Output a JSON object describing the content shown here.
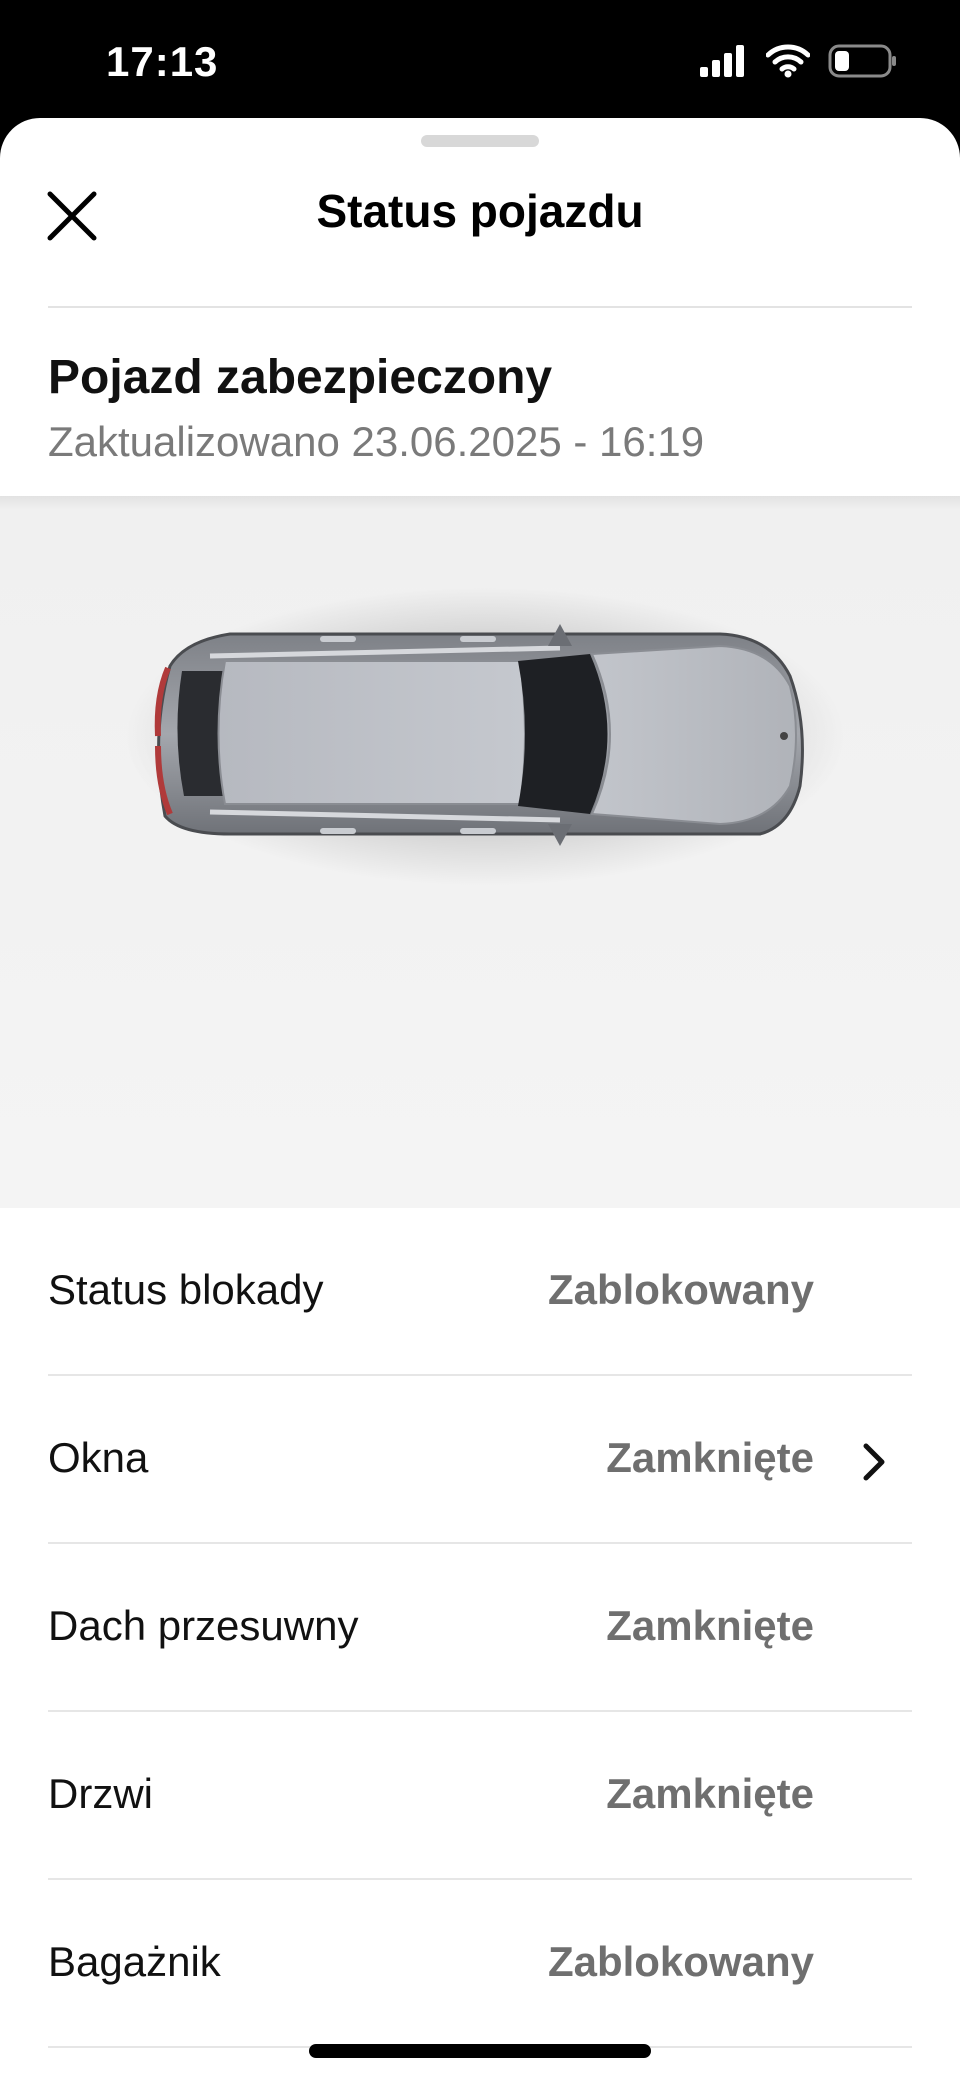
{
  "status_bar": {
    "time": "17:13"
  },
  "header": {
    "title": "Status pojazdu"
  },
  "summary": {
    "title": "Pojazd zabezpieczony",
    "updated": "Zaktualizowano 23.06.2025 - 16:19"
  },
  "rows": [
    {
      "label": "Status blokady",
      "value": "Zablokowany",
      "has_chevron": false
    },
    {
      "label": "Okna",
      "value": "Zamknięte",
      "has_chevron": true
    },
    {
      "label": "Dach przesuwny",
      "value": "Zamknięte",
      "has_chevron": false
    },
    {
      "label": "Drzwi",
      "value": "Zamknięte",
      "has_chevron": false
    },
    {
      "label": "Bagażnik",
      "value": "Zablokowany",
      "has_chevron": false
    }
  ],
  "icons": {
    "close": "close-icon",
    "chevron": "chevron-right-icon",
    "signal": "cellular-signal-icon",
    "wifi": "wifi-icon",
    "battery": "battery-icon"
  },
  "colors": {
    "accent_text": "#000000",
    "secondary_text": "#6f6f6f",
    "car_bg": "#f2f2f2"
  }
}
